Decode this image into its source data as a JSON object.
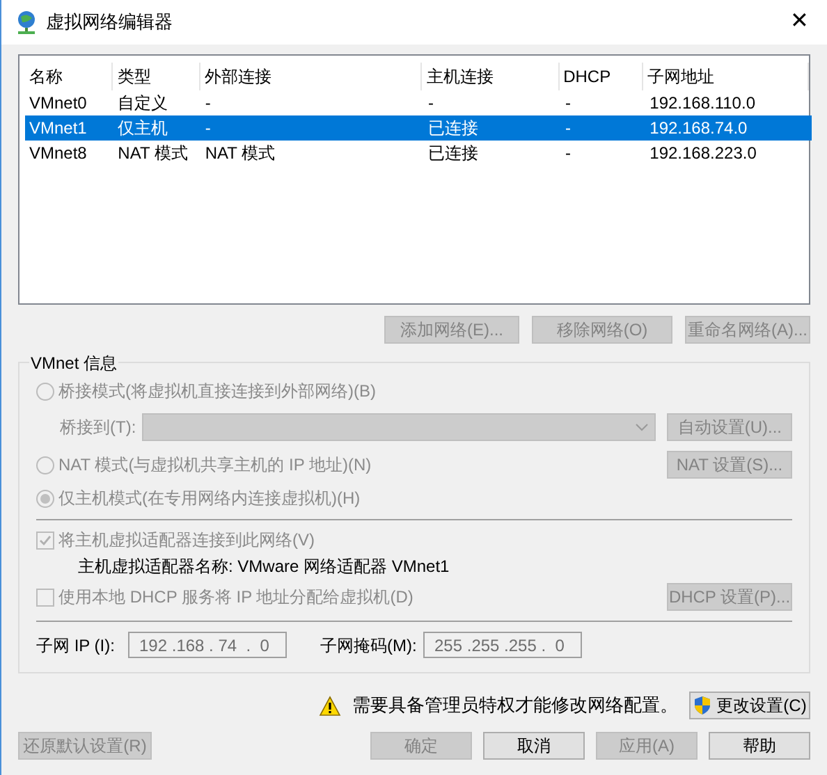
{
  "window": {
    "title": "虚拟网络编辑器",
    "close": "✕"
  },
  "table": {
    "columns": [
      "名称",
      "类型",
      "外部连接",
      "主机连接",
      "DHCP",
      "子网地址"
    ],
    "rows": [
      {
        "selected": false,
        "cells": [
          "VMnet0",
          "自定义",
          "-",
          "-",
          "-",
          "192.168.110.0"
        ]
      },
      {
        "selected": true,
        "cells": [
          "VMnet1",
          "仅主机",
          "-",
          "已连接",
          "-",
          "192.168.74.0"
        ]
      },
      {
        "selected": false,
        "cells": [
          "VMnet8",
          "NAT 模式",
          "NAT 模式",
          "已连接",
          "-",
          "192.168.223.0"
        ]
      }
    ]
  },
  "list_buttons": [
    {
      "label": "添加网络(E)...",
      "disabled": true
    },
    {
      "label": "移除网络(O)",
      "disabled": true
    },
    {
      "label": "重命名网络(A)...",
      "disabled": true
    }
  ],
  "group": {
    "title": "VMnet 信息",
    "modes": [
      {
        "label": "桥接模式(将虚拟机直接连接到外部网络)(B)",
        "selected": false,
        "disabled": true
      },
      {
        "label": "NAT 模式(与虚拟机共享主机的 IP 地址)(N)",
        "selected": false,
        "disabled": true
      },
      {
        "label": "仅主机模式(在专用网络内连接虚拟机)(H)",
        "selected": true,
        "disabled": true
      }
    ],
    "bridge_to": {
      "label": "桥接到(T):",
      "disabled": true
    },
    "auto_button": {
      "label": "自动设置(U)...",
      "disabled": true
    },
    "nat_button": {
      "label": "NAT 设置(S)...",
      "disabled": true
    },
    "connect_adapter": {
      "label": "将主机虚拟适配器连接到此网络(V)",
      "checked": true,
      "disabled": true
    },
    "adapter_name": "主机虚拟适配器名称: VMware 网络适配器 VMnet1",
    "dhcp": {
      "label": "使用本地 DHCP 服务将 IP 地址分配给虚拟机(D)",
      "checked": false,
      "disabled": true
    },
    "dhcp_button": {
      "label": "DHCP 设置(P)...",
      "disabled": true
    },
    "subnet_ip": {
      "label": "子网 IP (I):",
      "value": "192 .168 . 74  .  0"
    },
    "subnet_mask": {
      "label": "子网掩码(M):",
      "value": "255 .255 .255 .  0"
    }
  },
  "admin_notice": "需要具备管理员特权才能修改网络配置。",
  "change_settings": {
    "label": "更改设置(C)",
    "disabled": false
  },
  "restore_button": {
    "label": "还原默认设置(R)",
    "disabled": true
  },
  "footer_buttons": [
    {
      "label": "确定",
      "disabled": true
    },
    {
      "label": "取消",
      "disabled": false
    },
    {
      "label": "应用(A)",
      "disabled": true
    },
    {
      "label": "帮助",
      "disabled": false
    }
  ]
}
